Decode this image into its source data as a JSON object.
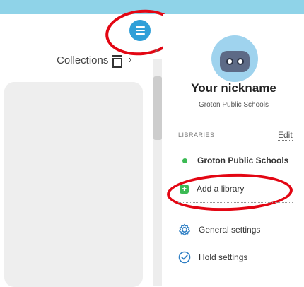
{
  "header": {
    "collections_label": "Collections"
  },
  "profile": {
    "nickname": "Your nickname",
    "school": "Groton Public Schools"
  },
  "libraries": {
    "section_label": "LIBRARIES",
    "edit_label": "Edit",
    "items": [
      {
        "name": "Groton Public Schools",
        "status_color": "#3cba54"
      }
    ],
    "add_label": "Add a library"
  },
  "settings": [
    {
      "label": "General settings",
      "icon": "gear-icon"
    },
    {
      "label": "Hold settings",
      "icon": "check-circle-icon"
    }
  ],
  "colors": {
    "accent": "#2f9fd8",
    "highlight": "#e30613",
    "success": "#3cba54"
  }
}
